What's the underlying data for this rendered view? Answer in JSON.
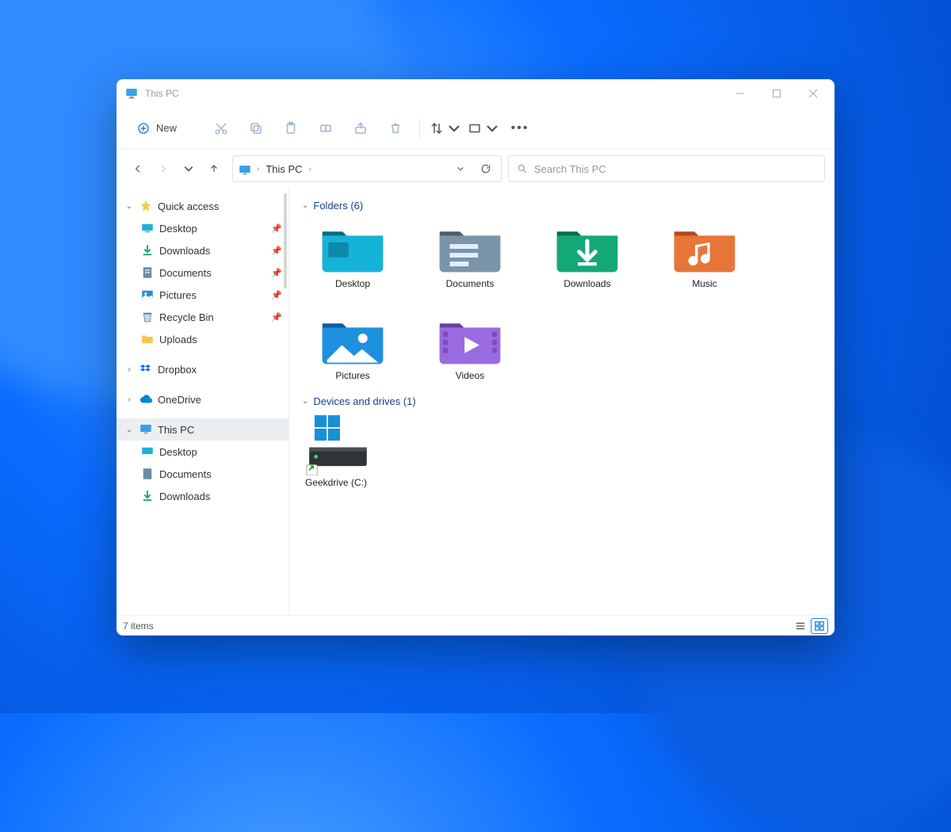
{
  "window": {
    "title": "This PC"
  },
  "toolbar": {
    "new_label": "New"
  },
  "address": {
    "crumb": "This PC"
  },
  "search": {
    "placeholder": "Search This PC"
  },
  "sidebar": {
    "quick_access": "Quick access",
    "items": [
      {
        "label": "Desktop",
        "pinned": true
      },
      {
        "label": "Downloads",
        "pinned": true
      },
      {
        "label": "Documents",
        "pinned": true
      },
      {
        "label": "Pictures",
        "pinned": true
      },
      {
        "label": "Recycle Bin",
        "pinned": true
      },
      {
        "label": "Uploads",
        "pinned": false
      }
    ],
    "dropbox": "Dropbox",
    "onedrive": "OneDrive",
    "this_pc": "This PC",
    "this_pc_children": [
      {
        "label": "Desktop"
      },
      {
        "label": "Documents"
      },
      {
        "label": "Downloads"
      }
    ]
  },
  "sections": {
    "folders_header": "Folders (6)",
    "drives_header": "Devices and drives (1)"
  },
  "folders": [
    {
      "label": "Desktop"
    },
    {
      "label": "Documents"
    },
    {
      "label": "Downloads"
    },
    {
      "label": "Music"
    },
    {
      "label": "Pictures"
    },
    {
      "label": "Videos"
    }
  ],
  "drives": [
    {
      "label": "Geekdrive (C:)"
    }
  ],
  "status": {
    "count": "7 items"
  }
}
